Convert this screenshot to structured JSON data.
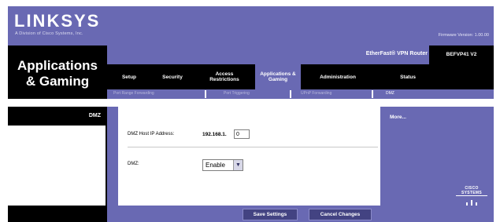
{
  "brand": {
    "logo": "LINKSYS",
    "logo_sub": "A Division of Cisco Systems, Inc.",
    "firmware": "Firmware Version: 1.00.00"
  },
  "header": {
    "section_title_line1": "Applications",
    "section_title_line2": "& Gaming",
    "product_name": "EtherFast® VPN Router",
    "model": "BEFVP41 V2"
  },
  "nav": {
    "tabs": [
      {
        "label": "Setup"
      },
      {
        "label": "Security"
      },
      {
        "label": "Access Restrictions"
      },
      {
        "label": "Applications & Gaming"
      },
      {
        "label": "Administration"
      },
      {
        "label": "Status"
      }
    ],
    "subtabs": [
      {
        "label": "Port Range Forwarding"
      },
      {
        "label": "Port Triggering"
      },
      {
        "label": "UPnP Forwarding"
      },
      {
        "label": "DMZ"
      }
    ]
  },
  "sidebar": {
    "section_label": "DMZ"
  },
  "form": {
    "dmz_host_label": "DMZ Host IP Address:",
    "ip_prefix": "192.168.1.",
    "ip_last_octet": "0",
    "dmz_label": "DMZ:",
    "dmz_value": "Enable"
  },
  "help": {
    "more_link": "More..."
  },
  "footer": {
    "save_label": "Save Settings",
    "cancel_label": "Cancel Changes"
  },
  "cisco": {
    "name": "CISCO SYSTEMS"
  },
  "colors": {
    "accent": "#6969b3",
    "dark": "#000000",
    "button": "#434382"
  }
}
